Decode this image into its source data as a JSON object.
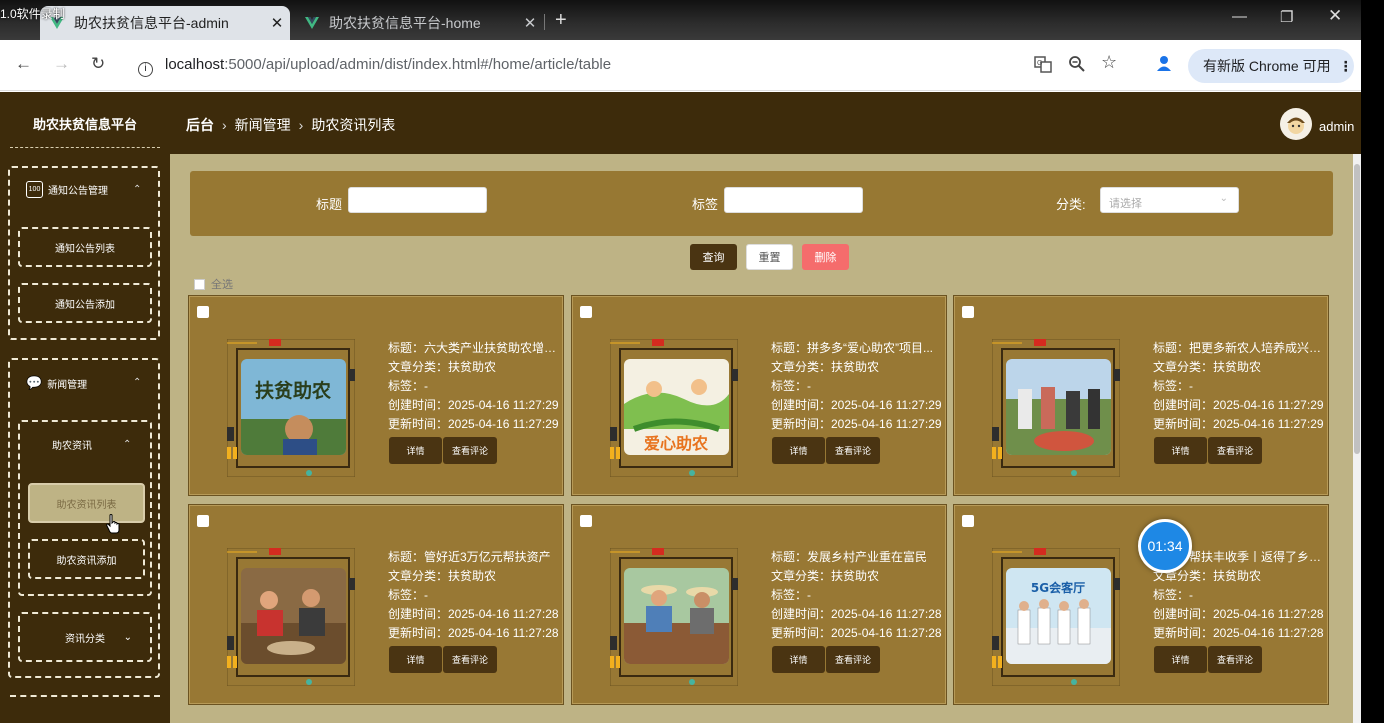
{
  "recorder": {
    "label": "1.0软件录制",
    "timer": "01:34"
  },
  "browser": {
    "tabs": [
      {
        "title": "助农扶贫信息平台-admin",
        "active": true
      },
      {
        "title": "助农扶贫信息平台-home",
        "active": false
      }
    ],
    "url_host": "localhost",
    "url_rest": ":5000/api/upload/admin/dist/index.html#/home/article/table",
    "update_label": "有新版 Chrome 可用",
    "accent": "#dde8f8"
  },
  "header": {
    "brand": "助农扶贫信息平台",
    "breadcrumb": [
      "后台",
      "新闻管理",
      "助农资讯列表"
    ],
    "username": "admin"
  },
  "sidebar": {
    "group1": {
      "title": "通知公告管理",
      "items": [
        "通知公告列表",
        "通知公告添加"
      ]
    },
    "group2": {
      "title": "新闻管理",
      "sub": "助农资讯",
      "items": [
        "助农资讯列表",
        "助农资讯添加"
      ],
      "other": "资讯分类"
    }
  },
  "filter": {
    "title_label": "标题",
    "tag_label": "标签",
    "category_label": "分类:",
    "category_placeholder": "请选择",
    "query": "查询",
    "reset": "重置",
    "delete": "删除",
    "select_all": "全选"
  },
  "card_labels": {
    "detail": "详情",
    "comments": "查看评论"
  },
  "articles": [
    {
      "title": "标题：六大类产业扶贫助农增收...",
      "category": "文章分类：扶贫助农",
      "tags": "标签：-",
      "created": "创建时间：2025-04-16 11:27:29",
      "updated": "更新时间：2025-04-16 11:27:29",
      "img_text": "扶贫助农"
    },
    {
      "title": "标题：拼多多“爱心助农”项目...",
      "category": "文章分类：扶贫助农",
      "tags": "标签：-",
      "created": "创建时间：2025-04-16 11:27:29",
      "updated": "更新时间：2025-04-16 11:27:29",
      "img_text": "爱心助农"
    },
    {
      "title": "标题：把更多新农人培养成兴农...",
      "category": "文章分类：扶贫助农",
      "tags": "标签：-",
      "created": "创建时间：2025-04-16 11:27:29",
      "updated": "更新时间：2025-04-16 11:27:29",
      "img_text": ""
    },
    {
      "title": "标题：管好近3万亿元帮扶资产",
      "category": "文章分类：扶贫助农",
      "tags": "标签：-",
      "created": "创建时间：2025-04-16 11:27:28",
      "updated": "更新时间：2025-04-16 11:27:28",
      "img_text": ""
    },
    {
      "title": "标题：发展乡村产业重在富民",
      "category": "文章分类：扶贫助农",
      "tags": "标签：-",
      "created": "创建时间：2025-04-16 11:27:28",
      "updated": "更新时间：2025-04-16 11:27:28",
      "img_text": ""
    },
    {
      "title": "标题：帮扶丰收季丨返得了乡，...",
      "category": "文章分类：扶贫助农",
      "tags": "标签：-",
      "created": "创建时间：2025-04-16 11:27:28",
      "updated": "更新时间：2025-04-16 11:27:28",
      "img_text": "5G会客厅"
    }
  ],
  "colors": {
    "header_bg": "#3d2b0b",
    "content_bg": "#beb385",
    "card_bg": "#987834",
    "delete_btn": "#f56c6c"
  }
}
